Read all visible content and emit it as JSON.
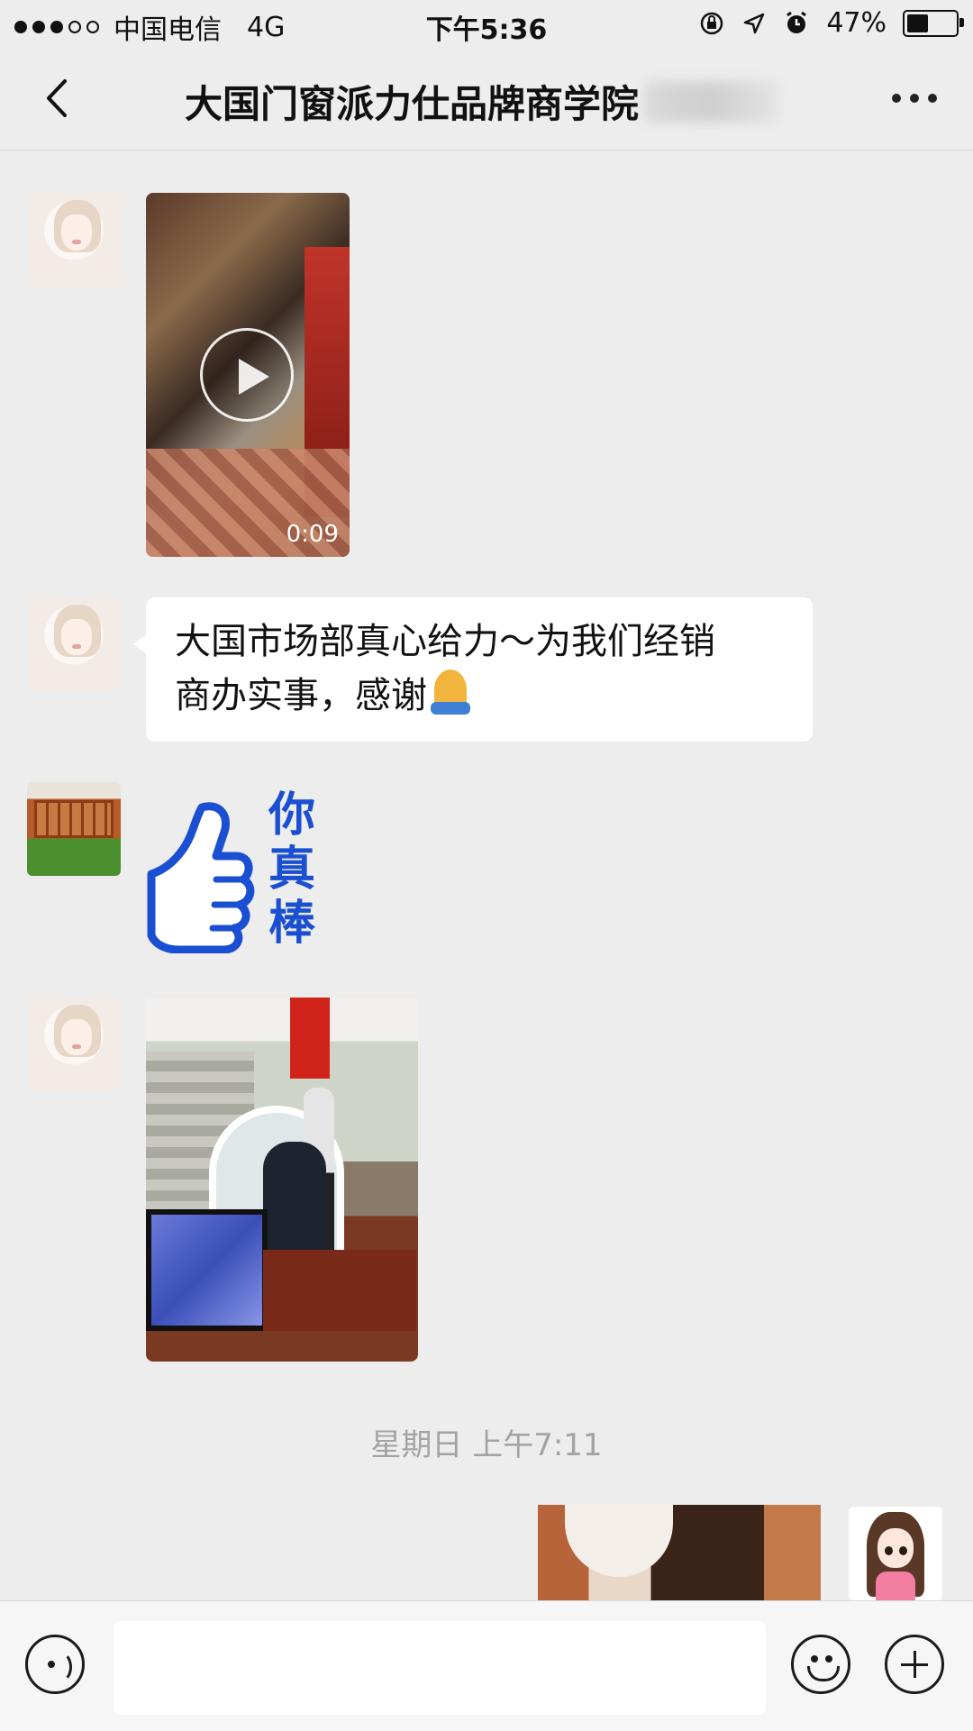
{
  "status_bar": {
    "carrier": "中国电信",
    "network": "4G",
    "time": "下午5:36",
    "battery": "47%",
    "battery_level": 0.47
  },
  "nav": {
    "title": "大国门窗派力仕品牌商学院",
    "back_icon": "chevron-left-icon",
    "more_icon": "more-dots-icon"
  },
  "messages": [
    {
      "type": "video",
      "duration": "0:09"
    },
    {
      "type": "text",
      "text_line1": "大国市场部真心给力～为我们经销",
      "text_line2": "商办实事，感谢"
    },
    {
      "type": "sticker",
      "chars": [
        "你",
        "真",
        "棒"
      ]
    },
    {
      "type": "image"
    }
  ],
  "timestamp": "星期日 上午7:11",
  "input_bar": {
    "voice_icon": "voice-icon",
    "emoji_icon": "emoji-icon",
    "plus_icon": "plus-icon"
  }
}
